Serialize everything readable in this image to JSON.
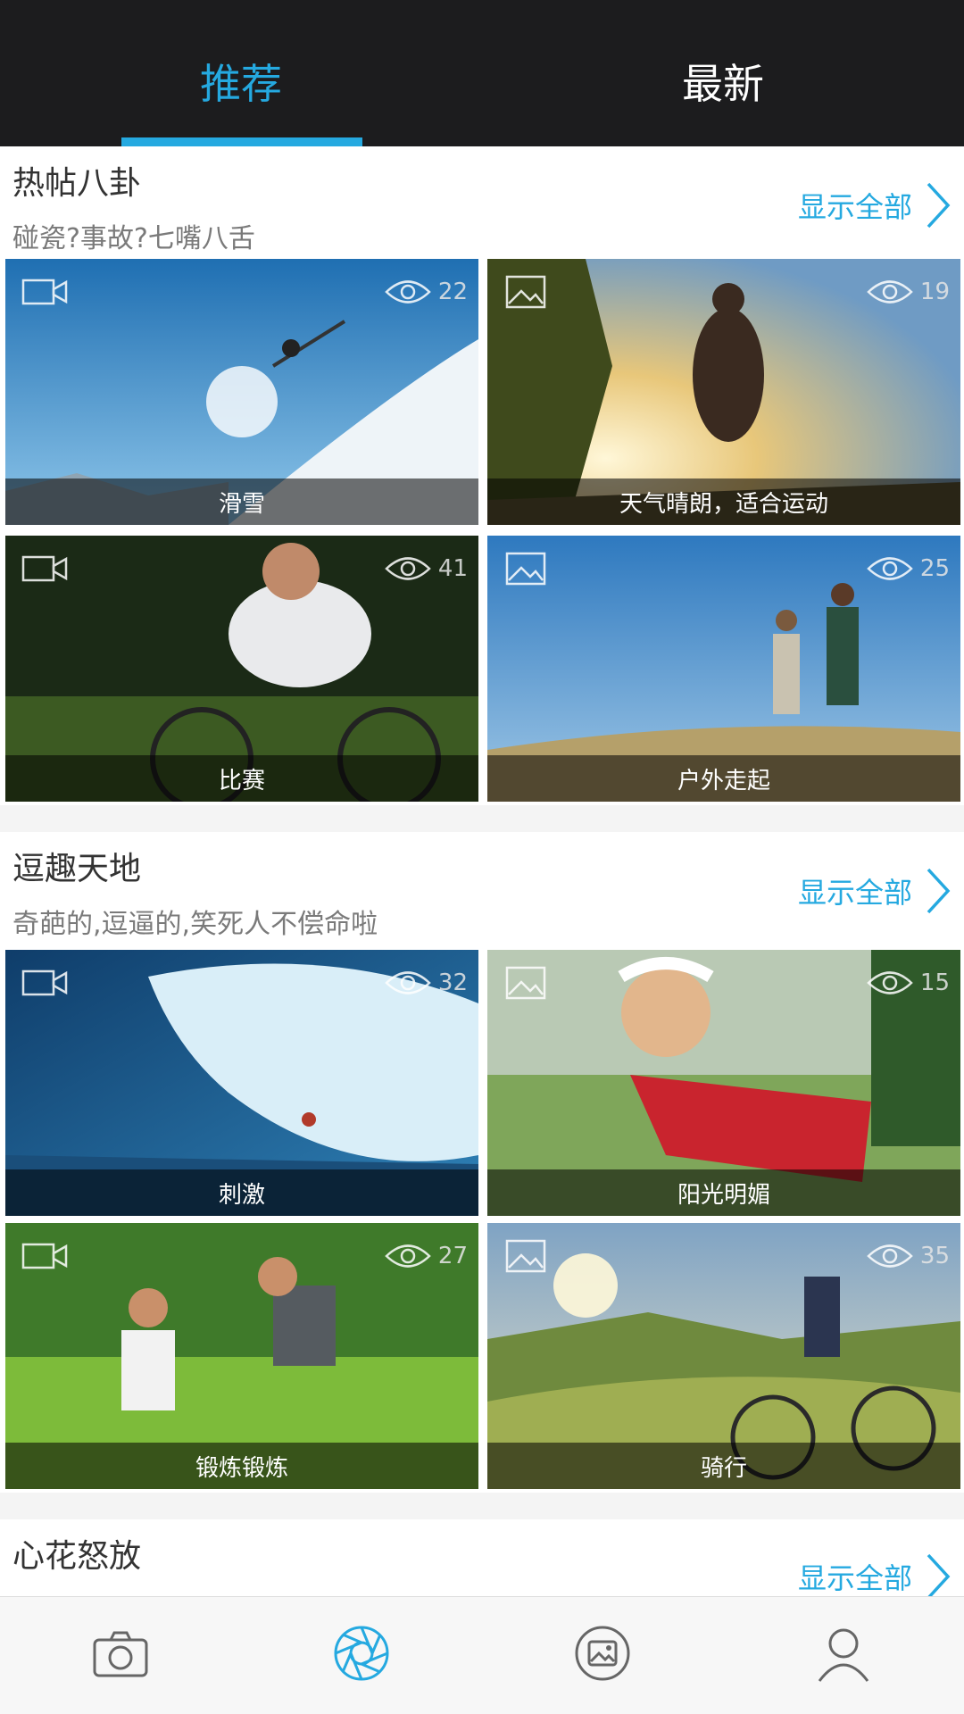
{
  "tabs": [
    {
      "label": "推荐",
      "active": true
    },
    {
      "label": "最新",
      "active": false
    }
  ],
  "accent_color": "#25a9e0",
  "sections": [
    {
      "title": "热帖八卦",
      "subtitle": "碰瓷?事故?七嘴八舌",
      "show_all": "显示全部",
      "cards": [
        {
          "caption": "滑雪",
          "type": "video-icon",
          "views": "22"
        },
        {
          "caption": "天气晴朗，适合运动",
          "type": "image-icon",
          "views": "19"
        },
        {
          "caption": "比赛",
          "type": "video-icon",
          "views": "41"
        },
        {
          "caption": "户外走起",
          "type": "image-icon",
          "views": "25"
        }
      ]
    },
    {
      "title": "逗趣天地",
      "subtitle": "奇葩的,逗逼的,笑死人不偿命啦",
      "show_all": "显示全部",
      "cards": [
        {
          "caption": "刺激",
          "type": "video-icon",
          "views": "32"
        },
        {
          "caption": "阳光明媚",
          "type": "image-icon",
          "views": "15"
        },
        {
          "caption": "锻炼锻炼",
          "type": "video-icon",
          "views": "27"
        },
        {
          "caption": "骑行",
          "type": "image-icon",
          "views": "35"
        }
      ]
    },
    {
      "title": "心花怒放",
      "subtitle": "",
      "show_all": "显示全部"
    }
  ],
  "bottom_nav": [
    {
      "icon": "camera-icon",
      "active": false
    },
    {
      "icon": "aperture-icon",
      "active": true
    },
    {
      "icon": "gallery-icon",
      "active": false
    },
    {
      "icon": "profile-icon",
      "active": false
    }
  ]
}
